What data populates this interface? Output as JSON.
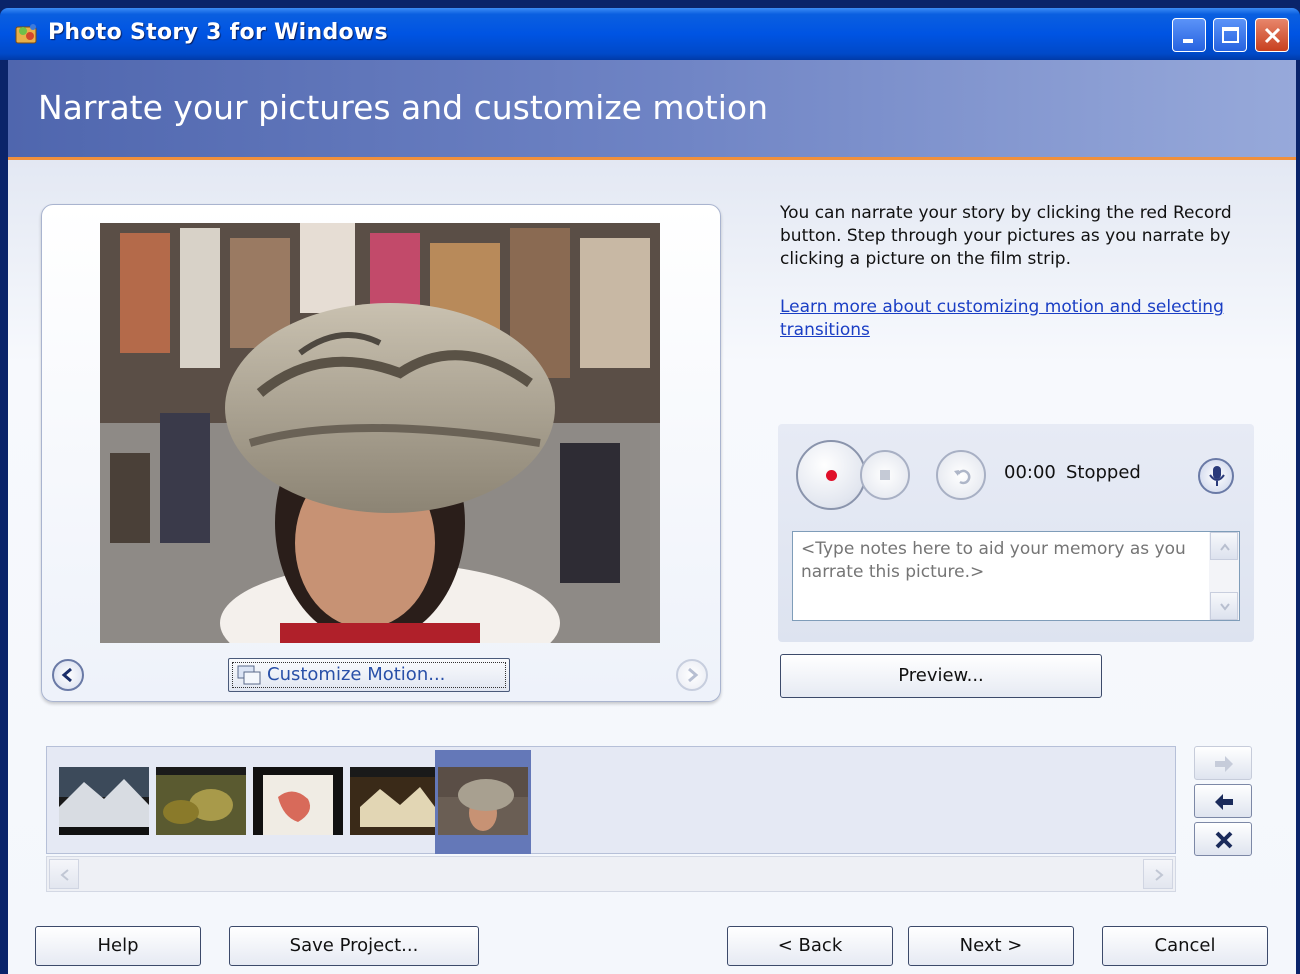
{
  "window": {
    "title": "Photo Story 3 for Windows"
  },
  "header": {
    "title": "Narrate your pictures and customize motion"
  },
  "viewer": {
    "customize_motion_label": "Customize Motion..."
  },
  "instructions": {
    "text": "You can narrate your story by clicking the red Record button. Step through your pictures as you narrate by clicking a picture on the film strip.",
    "link": "Learn more about customizing motion and selecting transitions"
  },
  "narration": {
    "time": "00:00",
    "status": "Stopped",
    "notes_placeholder": "<Type notes here to aid your memory as you narrate this picture.>"
  },
  "preview_label": "Preview...",
  "buttons": {
    "help": "Help",
    "save_project": "Save Project...",
    "back": "< Back",
    "next": "Next >",
    "cancel": "Cancel"
  },
  "colors": {
    "accent": "#f0903c",
    "title_bar": "#0054e3",
    "record": "#e0102a",
    "link": "#1a3ec4"
  }
}
